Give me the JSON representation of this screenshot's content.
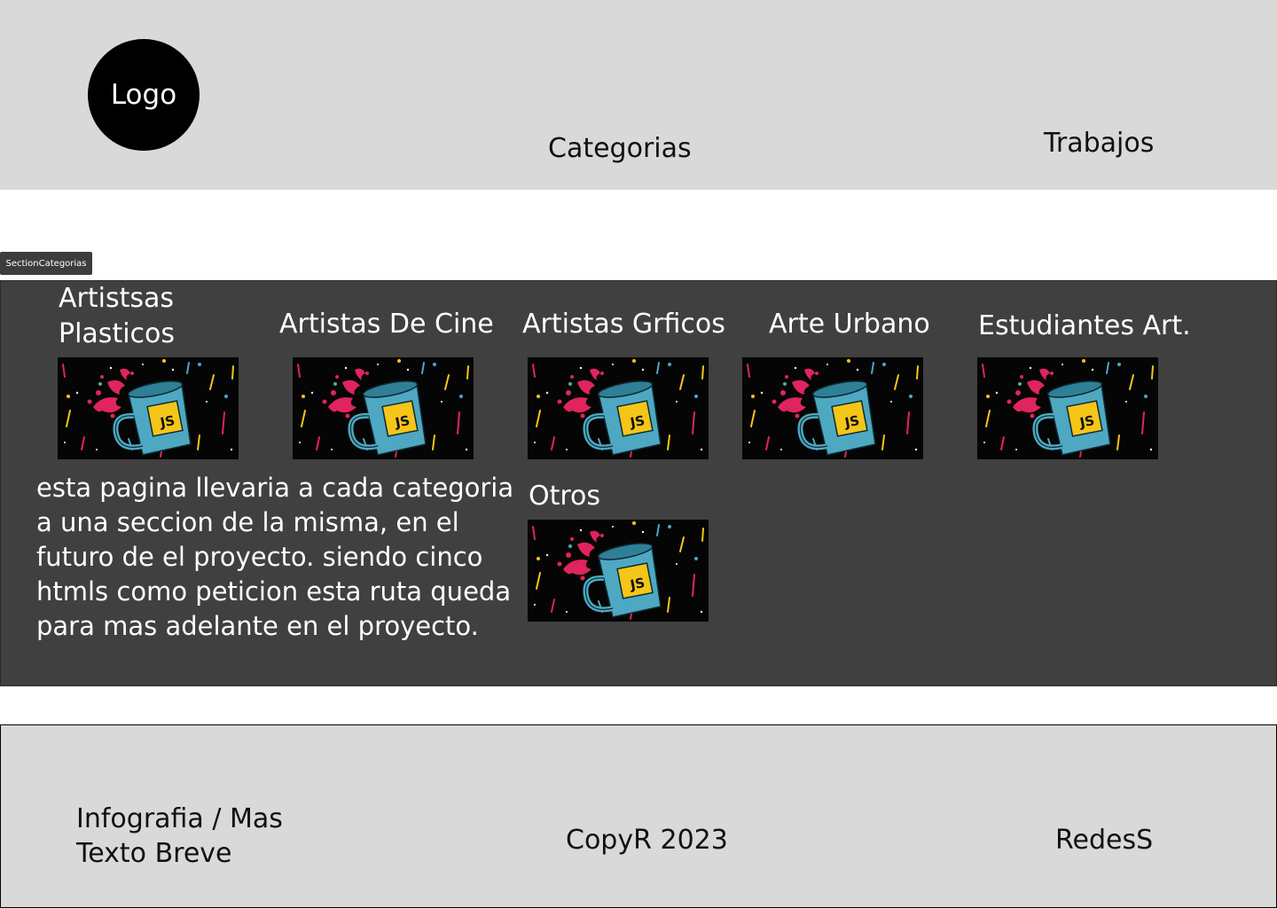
{
  "header": {
    "logo_label": "Logo",
    "nav": {
      "categorias": "Categorias",
      "trabajos": "Trabajos"
    }
  },
  "section": {
    "tag": "SectionCategorias",
    "categories": [
      {
        "title_line1": "Artistsas",
        "title_line2": "Plasticos",
        "image_icon": "js-coffee-mug-icon"
      },
      {
        "title": "Artistas De Cine",
        "image_icon": "js-coffee-mug-icon"
      },
      {
        "title": "Artistas Grficos",
        "image_icon": "js-coffee-mug-icon"
      },
      {
        "title": "Arte Urbano",
        "image_icon": "js-coffee-mug-icon"
      },
      {
        "title": "Estudiantes Art.",
        "image_icon": "js-coffee-mug-icon"
      },
      {
        "title": "Otros",
        "image_icon": "js-coffee-mug-icon"
      }
    ],
    "description": "esta pagina llevaria a cada categoria a una seccion de la misma, en el futuro de el proyecto. siendo cinco htmls como peticion esta ruta queda para mas adelante en el proyecto.",
    "thumb_badge_text": "JS"
  },
  "footer": {
    "info_line1": "Infografia / Mas",
    "info_line2": "Texto Breve",
    "copyright": "CopyR 2023",
    "social": "RedesS"
  },
  "colors": {
    "header_bg": "#d9d9d9",
    "section_bg": "#404040",
    "mug": "#4ea8c1",
    "badge": "#f5c518",
    "splash": "#e0245e"
  }
}
